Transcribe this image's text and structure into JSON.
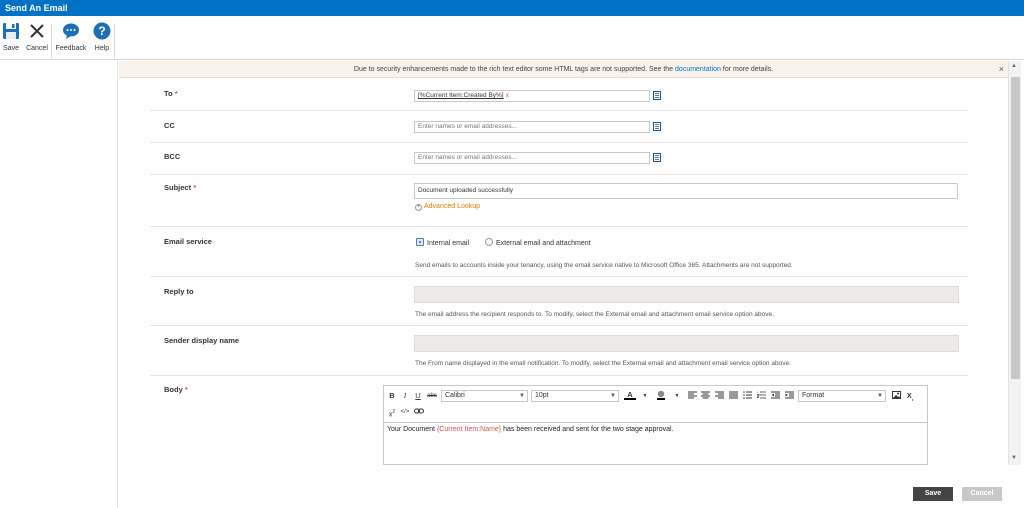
{
  "window": {
    "title": "Send An Email"
  },
  "ribbon": {
    "save": "Save",
    "cancel": "Cancel",
    "feedback": "Feedback",
    "help": "Help"
  },
  "notice": {
    "text": "Due to security enhancements made to the rich text editor some HTML tags are not supported. See the",
    "link": "documentation",
    "suffix": "for more details.",
    "close": "×"
  },
  "form": {
    "to": {
      "label": "To",
      "required": "*",
      "token": "[%Current Item:Created By%]",
      "token_remove": "x"
    },
    "cc": {
      "label": "CC",
      "placeholder": "Enter names or email addresses..."
    },
    "bcc": {
      "label": "BCC",
      "placeholder": "Enter names or email addresses..."
    },
    "subject": {
      "label": "Subject",
      "required": "*",
      "value": "Document uploaded successfully",
      "advanced_lookup": "Advanced Lookup"
    },
    "email_service": {
      "label": "Email service",
      "options": [
        "Internal email",
        "External email and attachment"
      ],
      "selected": "Internal email",
      "hint": "Send emails to accounts inside your tenancy, using the email service native to Microsoft Office 365. Attachments are not supported."
    },
    "reply_to": {
      "label": "Reply to",
      "hint": "The email address the recipient responds to. To modify, select the External email and attachment email service option above."
    },
    "sender_display_name": {
      "label": "Sender display name",
      "hint": "The From name displayed in the email notification. To modify, select the External email and attachment email service option above."
    },
    "body": {
      "label": "Body",
      "required": "*",
      "font": "Calibri",
      "size": "10pt",
      "format": "Format",
      "text_before": "Your Document",
      "reference": "{Current Item:Name}",
      "text_after": "has been received and sent for the two stage approval."
    }
  },
  "footer": {
    "save": "Save",
    "cancel": "Cancel"
  },
  "colors": {
    "titlebar": "#0072c6",
    "required": "#d9534f",
    "link": "#0072c6",
    "lookup": "#e07b00"
  },
  "icons": [
    "save-icon",
    "close-icon",
    "feedback-icon",
    "help-icon",
    "address-book-icon",
    "plus-circle-icon"
  ]
}
